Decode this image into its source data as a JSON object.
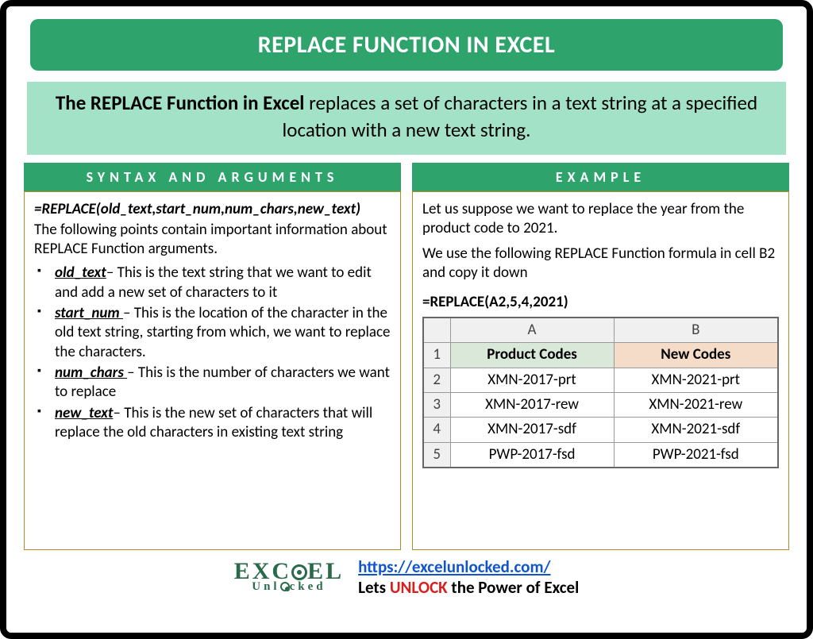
{
  "title": "REPLACE FUNCTION IN EXCEL",
  "intro": {
    "bold": "The REPLACE Function in Excel",
    "rest": " replaces a set of characters in a text string at a specified location with a new text string."
  },
  "syntax": {
    "header": "SYNTAX AND ARGUMENTS",
    "formula": "=REPLACE(old_text,start_num,num_chars,new_text)",
    "intro": "The following points contain important information about REPLACE Function arguments.",
    "args": [
      {
        "name": "old_text",
        "desc": "– This is the text string that we want to edit and add a new set of characters to it"
      },
      {
        "name": "start_num ",
        "desc": "– This is the location of the character in the old text string, starting from which, we want to replace the characters."
      },
      {
        "name": "num_chars ",
        "desc": "– This is the number of characters we want to replace"
      },
      {
        "name": "new_text",
        "desc": "– This is the new set of characters that will replace the old characters in existing text string"
      }
    ]
  },
  "example": {
    "header": "EXAMPLE",
    "p1": "Let us suppose we want to replace the year from the product code to 2021.",
    "p2": "We use the following REPLACE Function formula in cell B2 and copy it down",
    "formula": "=REPLACE(A2,5,4,2021)"
  },
  "table": {
    "colA": "A",
    "colB": "B",
    "hA": "Product Codes",
    "hB": "New Codes",
    "rows": [
      {
        "n": "2",
        "a": "XMN-2017-prt",
        "b": "XMN-2021-prt"
      },
      {
        "n": "3",
        "a": "XMN-2017-rew",
        "b": "XMN-2021-rew"
      },
      {
        "n": "4",
        "a": "XMN-2017-sdf",
        "b": "XMN-2021-sdf"
      },
      {
        "n": "5",
        "a": "PWP-2017-fsd",
        "b": "PWP-2021-fsd"
      }
    ]
  },
  "footer": {
    "logo_top": "EXC   EL",
    "logo_sub": "Unl   cked",
    "url": "https://excelunlocked.com/",
    "tag_pre": "Lets ",
    "tag_unlock": "UNLOCK",
    "tag_post": " the Power of Excel"
  }
}
